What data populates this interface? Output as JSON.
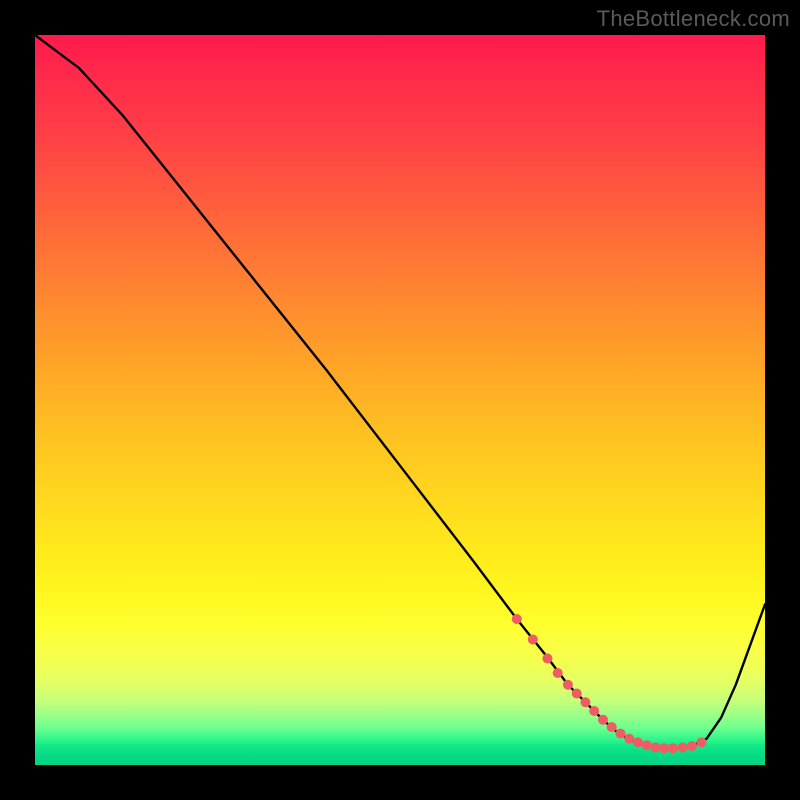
{
  "attribution": "TheBottleneck.com",
  "chart_data": {
    "type": "line",
    "title": "",
    "xlabel": "",
    "ylabel": "",
    "xlim": [
      0,
      100
    ],
    "ylim": [
      0,
      100
    ],
    "grid": false,
    "series": [
      {
        "name": "bottleneck-curve",
        "color": "#000000",
        "x": [
          0,
          4,
          6,
          12,
          20,
          30,
          40,
          50,
          60,
          66,
          70,
          73,
          75,
          78,
          80,
          82,
          84,
          86,
          88,
          90,
          92,
          94,
          96,
          100
        ],
        "y": [
          100,
          97,
          95.5,
          89,
          79,
          66.5,
          54,
          41,
          28,
          20,
          15,
          11,
          9,
          6,
          4.3,
          3.2,
          2.6,
          2.3,
          2.3,
          2.6,
          3.6,
          6.5,
          11,
          22
        ]
      }
    ],
    "markers": {
      "name": "dotted-valley",
      "color": "#f05c63",
      "radius": 5,
      "x": [
        66,
        68.2,
        70.2,
        71.6,
        73,
        74.2,
        75.4,
        76.6,
        77.8,
        79,
        80.2,
        81.4,
        82.6,
        83.8,
        85,
        86.2,
        87.4,
        88.7,
        90,
        91.3
      ],
      "y": [
        20,
        17.2,
        14.6,
        12.6,
        11,
        9.8,
        8.6,
        7.4,
        6.2,
        5.2,
        4.3,
        3.6,
        3.1,
        2.7,
        2.4,
        2.3,
        2.3,
        2.4,
        2.6,
        3.1
      ]
    }
  }
}
